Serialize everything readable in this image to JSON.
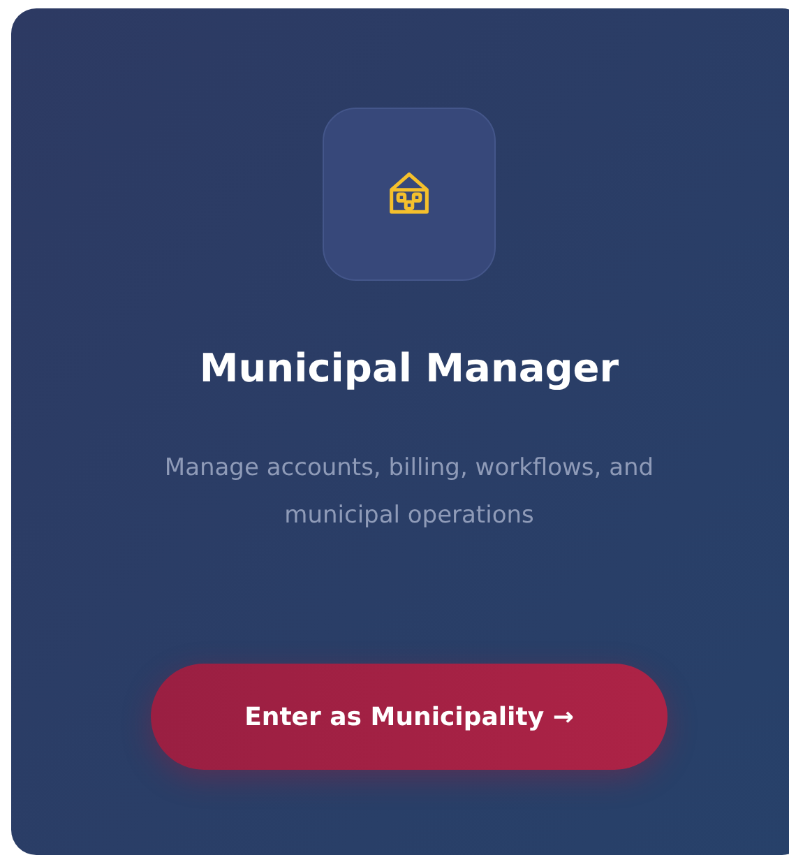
{
  "card": {
    "title": "Municipal Manager",
    "description": "Manage accounts, billing, workflows, and municipal operations",
    "button": "Enter as Municipality →"
  }
}
